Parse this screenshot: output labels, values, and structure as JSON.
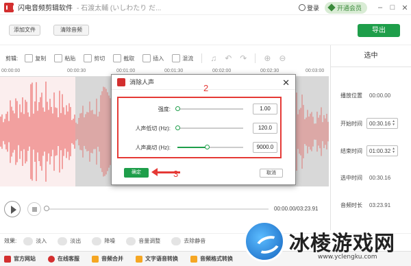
{
  "app": {
    "title": "闪电音频剪辑软件",
    "file_name": "- 石渡太輔 (いしわたり だ...",
    "login": "登录",
    "vip": "开通会员"
  },
  "toolbar": {
    "add_file": "添加文件",
    "clear_audio": "清除音频",
    "export": "导出"
  },
  "edit_tools": {
    "label": "剪辑:",
    "items": [
      "复制",
      "粘贴",
      "剪切",
      "截取",
      "插入",
      "混流"
    ]
  },
  "ruler": {
    "ticks": [
      "00:00:00",
      "00:00:30",
      "00:01:00",
      "00:01:30",
      "00:02:00",
      "00:02:30",
      "00:03:00"
    ]
  },
  "selection_panel": {
    "header": "选中",
    "play_position_label": "播放位置",
    "play_position_value": "00:00.00",
    "start_time_label": "开始时间",
    "start_time_value": "00:30.16",
    "end_time_label": "结束时间",
    "end_time_value": "01:00.32",
    "selected_duration_label": "选中时间",
    "selected_duration_value": "00:30.16",
    "audio_duration_label": "音频时长",
    "audio_duration_value": "03:23.91"
  },
  "player": {
    "time": "00:00.00/03:23.91",
    "progress": 0
  },
  "effects": {
    "label": "效果:",
    "items": [
      "淡入",
      "淡出",
      "降噪",
      "音量调整",
      "去除静音"
    ]
  },
  "footer": {
    "items": [
      "官方网站",
      "在线客服",
      "音频合并",
      "文字语音转换",
      "音频格式转换"
    ]
  },
  "dialog": {
    "title": "消除人声",
    "strength_label": "强度:",
    "strength_value": "1.00",
    "strength_fraction": 0.0,
    "low_cut_label": "人声低切 (Hz):",
    "low_cut_value": "120.0",
    "low_cut_fraction": 0.0,
    "high_cut_label": "人声高切 (Hz):",
    "high_cut_value": "9000.0",
    "high_cut_fraction": 0.45,
    "ok": "确定",
    "cancel": "取消",
    "annotation_2": "2",
    "annotation_3": "3"
  },
  "watermark": {
    "text": "冰棱游戏网",
    "url": "www.yclengku.com"
  },
  "colors": {
    "accent": "#1e9e4a",
    "brand": "#d32f2f",
    "annotation": "#e53935",
    "wave": "#e53935",
    "selection": "#d8d8d8"
  }
}
